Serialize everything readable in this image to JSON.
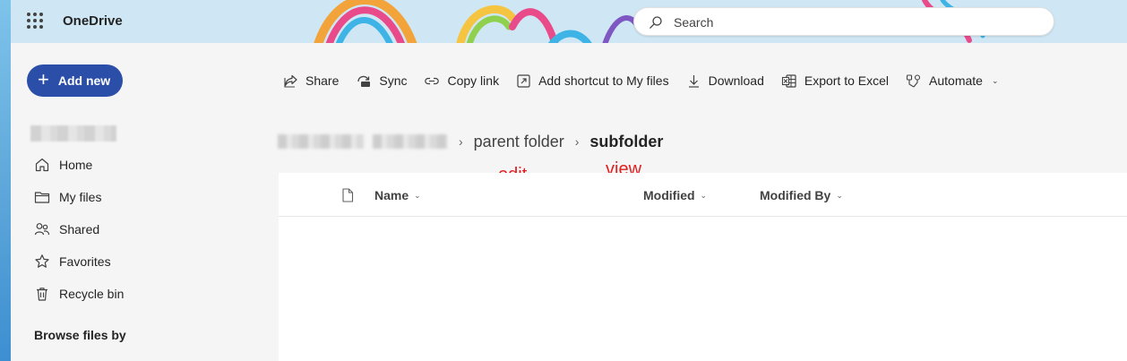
{
  "app": {
    "title": "OneDrive"
  },
  "search": {
    "placeholder": "Search"
  },
  "sidebar": {
    "add_new_label": "Add new",
    "items": [
      {
        "label": "Home",
        "icon": "home-icon"
      },
      {
        "label": "My files",
        "icon": "folder-icon"
      },
      {
        "label": "Shared",
        "icon": "people-icon"
      },
      {
        "label": "Favorites",
        "icon": "star-icon"
      },
      {
        "label": "Recycle bin",
        "icon": "trash-icon"
      }
    ],
    "browse_label": "Browse files by"
  },
  "toolbar": {
    "share": "Share",
    "sync": "Sync",
    "copy_link": "Copy link",
    "add_shortcut": "Add shortcut to My files",
    "download": "Download",
    "export_excel": "Export to Excel",
    "automate": "Automate"
  },
  "breadcrumb": {
    "parent": "parent folder",
    "current": "subfolder"
  },
  "annotations": {
    "edit": "edit",
    "view": "view"
  },
  "list": {
    "columns": {
      "name": "Name",
      "modified": "Modified",
      "modified_by": "Modified By"
    },
    "rows": []
  },
  "colors": {
    "accent": "#2b4fa8",
    "annotation": "#e02020",
    "header_bg": "#cfe7f4"
  }
}
